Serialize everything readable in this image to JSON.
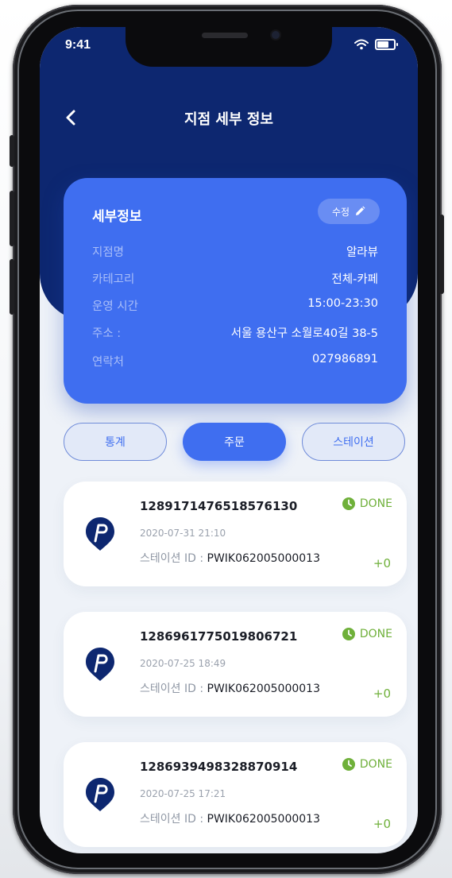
{
  "status_bar": {
    "time": "9:41"
  },
  "header": {
    "title": "지점 세부 정보"
  },
  "info_card": {
    "heading": "세부정보",
    "edit_label": "수정",
    "rows": [
      {
        "label": "지점명",
        "value": "알라뷰"
      },
      {
        "label": "카테고리",
        "value": "전체-카페"
      },
      {
        "label": "운영 시간",
        "value": "15:00-23:30"
      },
      {
        "label": "주소 :",
        "value": "서울 용산구 소월로40길 38-5"
      },
      {
        "label": "연락처",
        "value": "027986891"
      }
    ]
  },
  "tabs": [
    {
      "label": "통계",
      "active": false
    },
    {
      "label": "주문",
      "active": true
    },
    {
      "label": "스테이션",
      "active": false
    }
  ],
  "orders": [
    {
      "id": "1289171476518576130",
      "date": "2020-07-31 21:10",
      "station_label": "스테이션 ID : ",
      "station_id": "PWIK062005000013",
      "status": "DONE",
      "points": "+0"
    },
    {
      "id": "1286961775019806721",
      "date": "2020-07-25 18:49",
      "station_label": "스테이션 ID : ",
      "station_id": "PWIK062005000013",
      "status": "DONE",
      "points": "+0"
    },
    {
      "id": "1286939498328870914",
      "date": "2020-07-25 17:21",
      "station_label": "스테이션 ID : ",
      "station_id": "PWIK062005000013",
      "status": "DONE",
      "points": "+0"
    }
  ],
  "colors": {
    "header_navy": "#0d2770",
    "accent_blue": "#3f6ef0",
    "done_green": "#6fb03a"
  },
  "icons": {
    "back": "chevron-left-icon",
    "edit": "pencil-icon",
    "status": "clock-icon",
    "logo": "brand-pin-logo",
    "wifi": "wifi-icon",
    "battery": "battery-icon"
  }
}
